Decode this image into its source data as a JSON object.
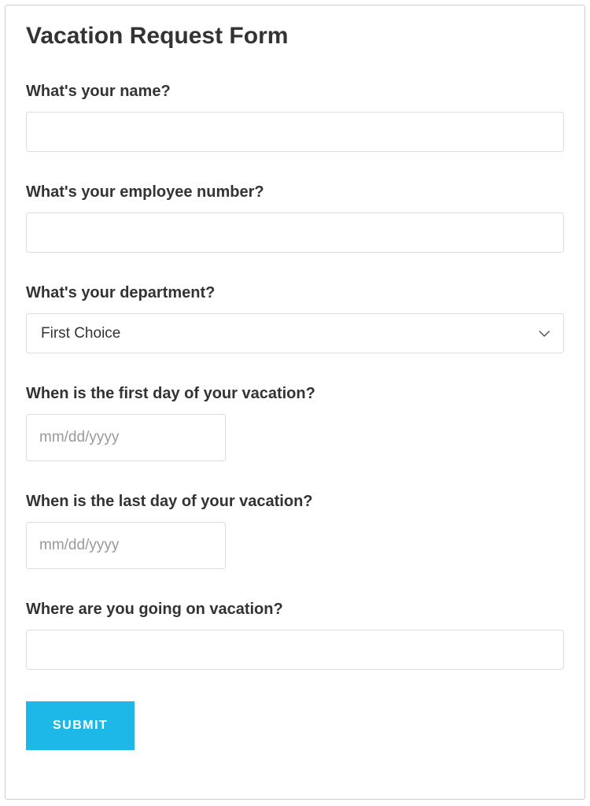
{
  "form": {
    "title": "Vacation Request Form",
    "fields": {
      "name": {
        "label": "What's your name?"
      },
      "employee_number": {
        "label": "What's your employee number?"
      },
      "department": {
        "label": "What's your department?",
        "selected": "First Choice"
      },
      "first_day": {
        "label": "When is the first day of your vacation?",
        "placeholder": "mm/dd/yyyy"
      },
      "last_day": {
        "label": "When is the last day of your vacation?",
        "placeholder": "mm/dd/yyyy"
      },
      "destination": {
        "label": "Where are you going on vacation?"
      }
    },
    "submit_label": "SUBMIT"
  }
}
